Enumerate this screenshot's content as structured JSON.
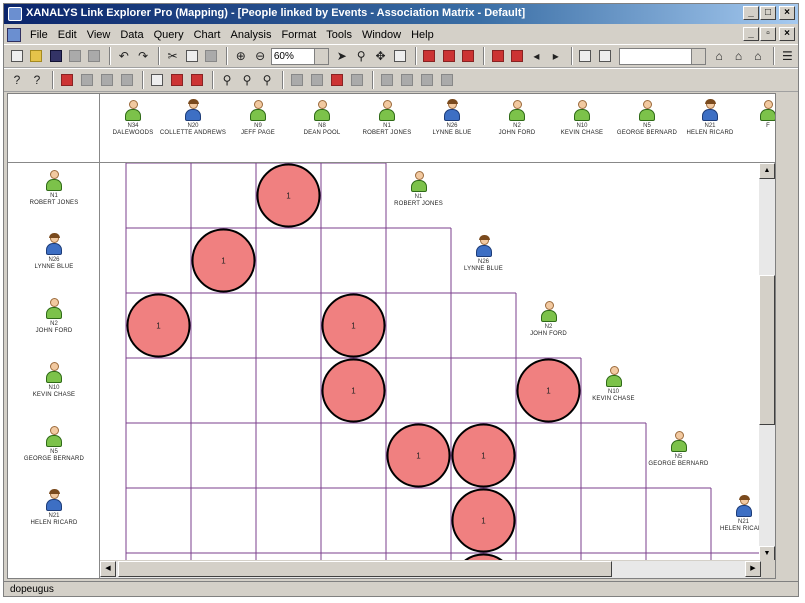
{
  "window": {
    "title": "XANALYS Link Explorer Pro (Mapping) - [People linked by Events - Association Matrix - Default]",
    "controls": [
      "_",
      "□",
      "×"
    ]
  },
  "menubar": {
    "items": [
      "File",
      "Edit",
      "View",
      "Data",
      "Query",
      "Chart",
      "Analysis",
      "Format",
      "Tools",
      "Window",
      "Help"
    ],
    "mdi_controls": [
      "_",
      "▫",
      "×"
    ]
  },
  "toolbar": {
    "zoom": "60%"
  },
  "columns": [
    {
      "id": "N34",
      "name": "DALEWOODS",
      "gender": "male"
    },
    {
      "id": "N20",
      "name": "COLLETTE ANDREWS",
      "gender": "female"
    },
    {
      "id": "N9",
      "name": "JEFF PAGE",
      "gender": "male"
    },
    {
      "id": "N8",
      "name": "DEAN POOL",
      "gender": "male"
    },
    {
      "id": "N1",
      "name": "ROBERT JONES",
      "gender": "male"
    },
    {
      "id": "N26",
      "name": "LYNNE BLUE",
      "gender": "female"
    },
    {
      "id": "N2",
      "name": "JOHN FORD",
      "gender": "male"
    },
    {
      "id": "N10",
      "name": "KEVIN CHASE",
      "gender": "male"
    },
    {
      "id": "N5",
      "name": "GEORGE BERNARD",
      "gender": "male"
    },
    {
      "id": "N21",
      "name": "HELEN RICARD",
      "gender": "female"
    },
    {
      "id": "",
      "name": "F",
      "gender": "male"
    }
  ],
  "rows": [
    {
      "id": "N1",
      "name": "ROBERT JONES",
      "gender": "male"
    },
    {
      "id": "N26",
      "name": "LYNNE BLUE",
      "gender": "female"
    },
    {
      "id": "N2",
      "name": "JOHN FORD",
      "gender": "male"
    },
    {
      "id": "N10",
      "name": "KEVIN CHASE",
      "gender": "male"
    },
    {
      "id": "N5",
      "name": "GEORGE BERNARD",
      "gender": "male"
    },
    {
      "id": "N21",
      "name": "HELEN RICARD",
      "gender": "female"
    }
  ],
  "diagonal_labels": [
    {
      "id": "N1",
      "name": "ROBERT JONES",
      "gender": "male"
    },
    {
      "id": "N26",
      "name": "LYNNE BLUE",
      "gender": "female"
    },
    {
      "id": "N2",
      "name": "JOHN FORD",
      "gender": "male"
    },
    {
      "id": "N10",
      "name": "KEVIN CHASE",
      "gender": "male"
    },
    {
      "id": "N5",
      "name": "GEORGE BERNARD",
      "gender": "male"
    },
    {
      "id": "N21",
      "name": "HELEN RICARD",
      "gender": "female"
    }
  ],
  "links": [
    {
      "row": 0,
      "col": 2,
      "value": "1"
    },
    {
      "row": 1,
      "col": 1,
      "value": "1"
    },
    {
      "row": 2,
      "col": 0,
      "value": "1"
    },
    {
      "row": 2,
      "col": 3,
      "value": "1"
    },
    {
      "row": 3,
      "col": 3,
      "value": "1"
    },
    {
      "row": 3,
      "col": 6,
      "value": "1"
    },
    {
      "row": 4,
      "col": 4,
      "value": "1"
    },
    {
      "row": 4,
      "col": 5,
      "value": "1"
    },
    {
      "row": 5,
      "col": 5,
      "value": "1"
    },
    {
      "row": 6,
      "col": 5,
      "value": ""
    }
  ],
  "colors": {
    "link_fill": "#f08080",
    "link_stroke": "#000000",
    "grid": "#7b3f8c"
  },
  "statusbar": {
    "text": "dopeugus"
  }
}
